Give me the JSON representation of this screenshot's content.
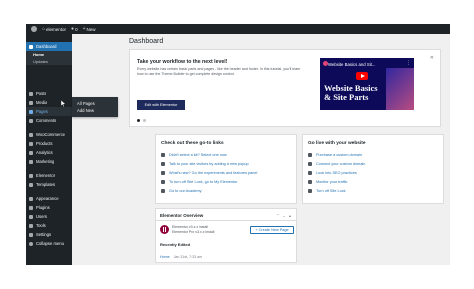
{
  "adminbar": {
    "site_name": "elementor",
    "comments_count": "0",
    "new_label": "New"
  },
  "sidebar": {
    "dashboard_label": "Dashboard",
    "sub_home": "Home",
    "sub_updates": "Updates",
    "items": [
      "Posts",
      "Media",
      "Pages",
      "Comments",
      "WooCommerce",
      "Products",
      "Analytics",
      "Marketing",
      "Elementor",
      "Templates",
      "Appearance",
      "Plugins",
      "Users",
      "Tools",
      "Settings",
      "Collapse menu"
    ]
  },
  "flyout": {
    "items": [
      "All Pages",
      "Add New"
    ]
  },
  "main": {
    "title": "Dashboard"
  },
  "welcome": {
    "heading": "Take your workflow to the next level!",
    "description": "Every website has certain basic parts and pages - like the header and footer. In this tutorial, you'll learn how to use the Theme Builder to get complete design control.",
    "button": "Edit with Elementor",
    "close": "✕",
    "video": {
      "title": "Website Basics and Sit...",
      "big_line1": "Website Basics",
      "big_line2": "& Site Parts"
    }
  },
  "golinks": {
    "heading": "Check out these go-to links",
    "items": [
      "Didn't select a kit? Select one now",
      "Talk to your site visitors by adding a new popup",
      "What's new? Go the experiments and features panel",
      "To turn off Site Lock, go to My Elementor",
      "Go to our Academy"
    ]
  },
  "withsite": {
    "heading": "Go live with your website",
    "items": [
      "Purchase a custom domain",
      "Connect your custom domain",
      "Look into SEO practices",
      "Monitor your traffic",
      "Turn off Site Lock"
    ]
  },
  "overview": {
    "heading": "Elementor Overview",
    "controls": "⌃ ⌄ ▴",
    "version_line1": "Elementor v3.x.x install",
    "version_line2": "Elementor Pro v3.x.x install",
    "create_button": "+ Create New Page",
    "recently_edited": "Recently Edited",
    "recent_link": "Home",
    "recent_date": "Jan 31st, 7:33 am"
  },
  "colors": {
    "admin_dark": "#1d2327",
    "accent_blue": "#2271b1",
    "elementor_navy": "#1f2a5c",
    "elementor_red": "#92003b"
  }
}
